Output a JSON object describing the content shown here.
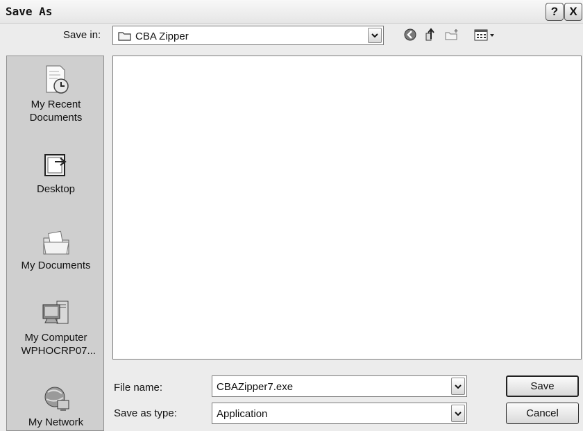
{
  "window": {
    "title": "Save As",
    "help_label": "?",
    "close_label": "X"
  },
  "toolbar": {
    "save_in_label": "Save in:",
    "save_in_value": "CBA Zipper",
    "icons": [
      "back-icon",
      "up-folder-icon",
      "new-folder-icon",
      "view-menu-icon"
    ]
  },
  "places": [
    {
      "label": "My Recent Documents",
      "icon": "recent-documents-icon"
    },
    {
      "label": "Desktop",
      "icon": "desktop-icon"
    },
    {
      "label": "My Documents",
      "icon": "my-documents-icon"
    },
    {
      "label": "My Computer WPHOCRP07...",
      "icon": "my-computer-icon"
    },
    {
      "label": "My Network",
      "icon": "my-network-icon"
    }
  ],
  "form": {
    "file_name_label": "File name:",
    "file_name_value": "CBAZipper7.exe",
    "save_type_label": "Save as type:",
    "save_type_value": "Application"
  },
  "buttons": {
    "save": "Save",
    "cancel": "Cancel"
  }
}
